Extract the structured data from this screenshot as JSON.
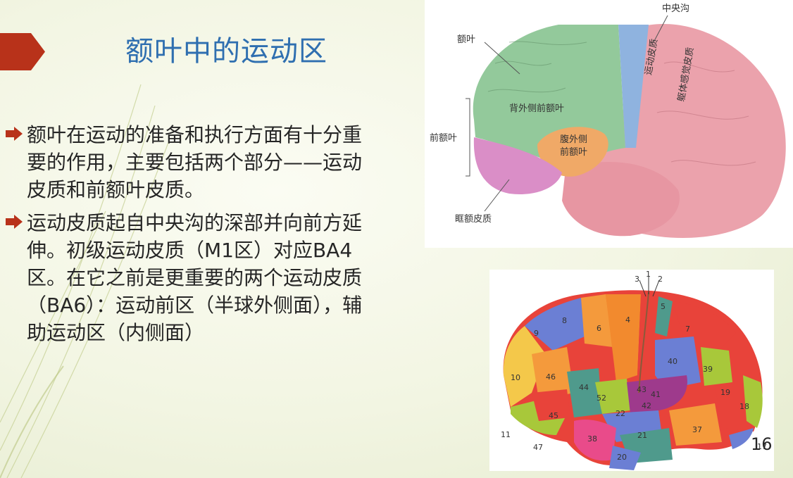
{
  "slide": {
    "title": "额叶中的运动区",
    "bullets": [
      "额叶在运动的准备和执行方面有十分重要的作用，主要包括两个部分——运动皮质和前额叶皮质。",
      "运动皮质起自中央沟的深部并向前方延伸。初级运动皮质（M1区）对应BA4区。在它之前是更重要的两个运动皮质（BA6）：运动前区（半球外侧面），辅助运动区（内侧面）"
    ],
    "page_number": "16",
    "accent_color": "#b8321a",
    "title_color": "#2f6fb0"
  },
  "figure1": {
    "labels": {
      "central_sulcus": "中央沟",
      "frontal_lobe": "额叶",
      "prefrontal": "前额叶",
      "orbitofrontal": "眶额皮质",
      "dorsolateral": "背外侧前额叶",
      "ventrolateral_1": "腹外侧",
      "ventrolateral_2": "前额叶",
      "motor_cortex": "运动皮质",
      "somatosensory": "躯体感觉皮质"
    }
  },
  "figure2": {
    "areas": [
      "3",
      "1",
      "2",
      "5",
      "8",
      "6",
      "4",
      "7",
      "9",
      "40",
      "39",
      "46",
      "10",
      "44",
      "52",
      "43",
      "41",
      "42",
      "19",
      "22",
      "18",
      "45",
      "11",
      "47",
      "38",
      "21",
      "37",
      "20",
      "17"
    ]
  }
}
